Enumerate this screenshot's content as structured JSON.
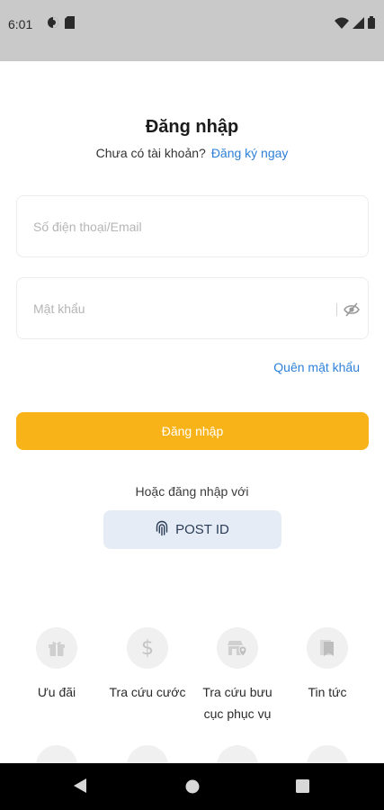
{
  "status_bar": {
    "time": "6:01"
  },
  "header": {
    "title": "Đăng nhập",
    "no_account_text": "Chưa có tài khoản?",
    "register_link": "Đăng ký ngay"
  },
  "form": {
    "phone_placeholder": "Số điện thoại/Email",
    "password_placeholder": "Mật khẩu",
    "forgot_password": "Quên mật khẩu",
    "login_button": "Đăng nhập"
  },
  "alt_login": {
    "or_text": "Hoặc đăng nhập với",
    "postid_label": "POST ID"
  },
  "quick_links": [
    {
      "label": "Ưu đãi",
      "icon": "gift-icon"
    },
    {
      "label": "Tra cứu cước",
      "icon": "dollar-icon"
    },
    {
      "label": "Tra cứu bưu cục phục vụ",
      "icon": "store-location-icon"
    },
    {
      "label": "Tin tức",
      "icon": "bookmark-icon"
    }
  ],
  "colors": {
    "accent": "#f8b319",
    "link": "#2f80d8",
    "status_bar": "#c9c9c9",
    "postid_bg": "#e6ecf6"
  }
}
